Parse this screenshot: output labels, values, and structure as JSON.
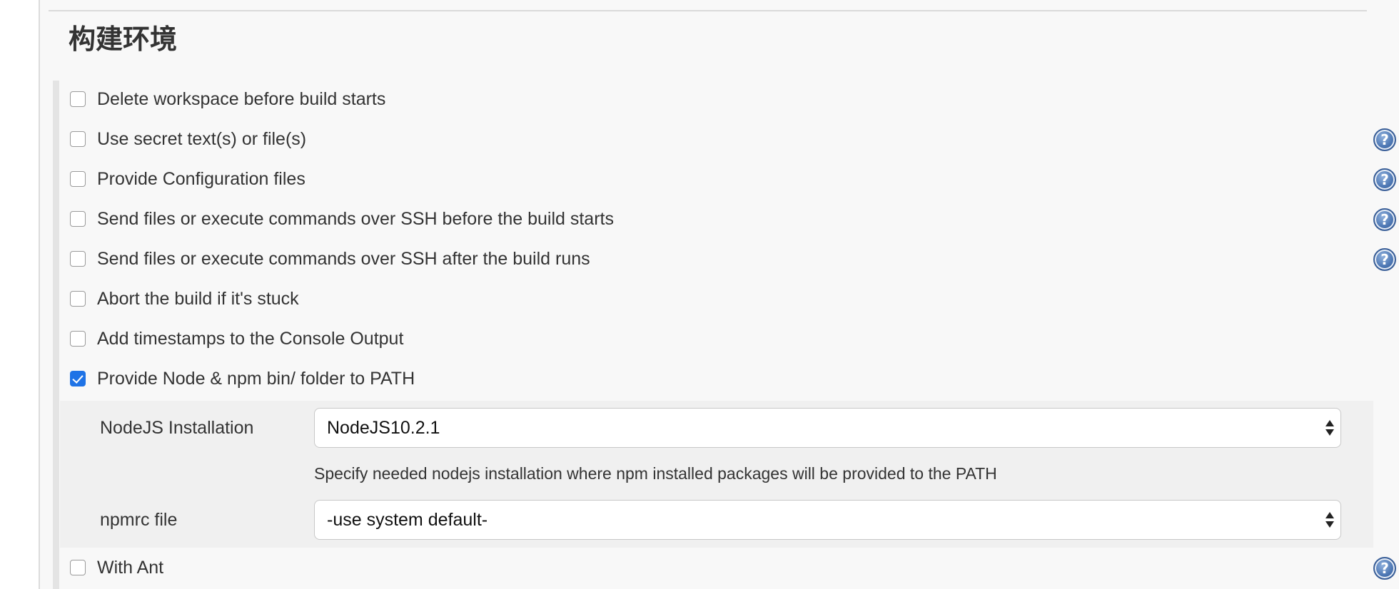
{
  "section": {
    "title": "构建环境"
  },
  "options": [
    {
      "label": "Delete workspace before build starts",
      "checked": false,
      "help": false
    },
    {
      "label": "Use secret text(s) or file(s)",
      "checked": false,
      "help": true
    },
    {
      "label": "Provide Configuration files",
      "checked": false,
      "help": true
    },
    {
      "label": "Send files or execute commands over SSH before the build starts",
      "checked": false,
      "help": true
    },
    {
      "label": "Send files or execute commands over SSH after the build runs",
      "checked": false,
      "help": true
    },
    {
      "label": "Abort the build if it's stuck",
      "checked": false,
      "help": false
    },
    {
      "label": "Add timestamps to the Console Output",
      "checked": false,
      "help": false
    },
    {
      "label": "Provide Node & npm bin/ folder to PATH",
      "checked": true,
      "help": false
    },
    {
      "label": "With Ant",
      "checked": false,
      "help": true
    }
  ],
  "node_config": {
    "installation_label": "NodeJS Installation",
    "installation_value": "NodeJS10.2.1",
    "installation_hint": "Specify needed nodejs installation where npm installed packages will be provided to the PATH",
    "npmrc_label": "npmrc file",
    "npmrc_value": "-use system default-"
  },
  "icons": {
    "help": "question-mark",
    "help_glyph": "?"
  },
  "colors": {
    "checkbox_checked": "#1f73e6",
    "help_icon": "#4e78b4",
    "panel_background": "#f8f8f8"
  }
}
